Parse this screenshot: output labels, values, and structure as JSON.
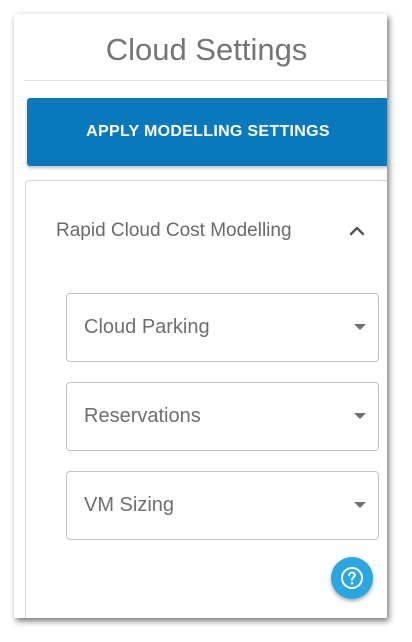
{
  "header": {
    "title": "Cloud Settings"
  },
  "toolbar": {
    "apply_label": "APPLY MODELLING SETTINGS"
  },
  "section": {
    "label": "Rapid Cloud Cost Modelling",
    "expanded": true,
    "toggle_icon": "chevron-up-icon",
    "selects": [
      {
        "label": "Cloud Parking",
        "icon": "caret-down-icon"
      },
      {
        "label": "Reservations",
        "icon": "caret-down-icon"
      },
      {
        "label": "VM Sizing",
        "icon": "caret-down-icon"
      }
    ]
  },
  "help": {
    "icon": "help-circle-icon"
  },
  "colors": {
    "primary": "#0a78bd",
    "help": "#2aa7e2",
    "title_text": "#757575",
    "border": "#c4c4c4"
  }
}
